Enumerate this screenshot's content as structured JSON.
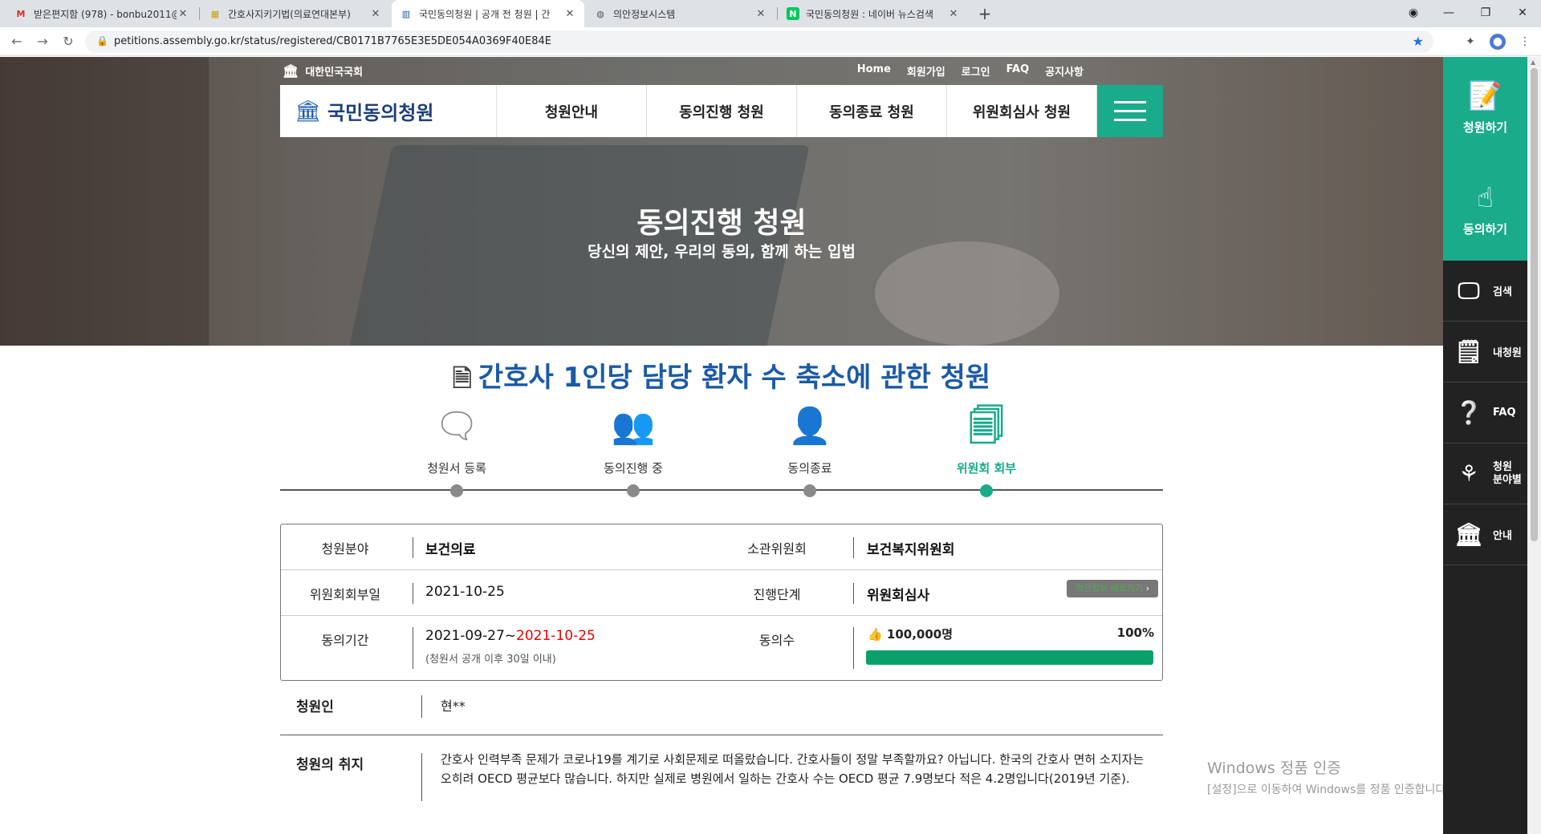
{
  "browser": {
    "tabs": [
      {
        "title": "받은편지함 (978) - bonbu2011@",
        "favicon": "M"
      },
      {
        "title": "간호사지키기법(의료연대본부)",
        "favicon": "▦"
      },
      {
        "title": "국민동의청원 | 공개 전 청원 | 간",
        "favicon": "▥"
      },
      {
        "title": "의안정보시스템",
        "favicon": "◍"
      },
      {
        "title": "국민동의청원 : 네이버 뉴스검색",
        "favicon": "N"
      }
    ],
    "new_tab": "+",
    "url": "petitions.assembly.go.kr/status/registered/CB0171B7765E3E5DE054A0369F40E84E"
  },
  "site": {
    "gov_name": "대한민국국회",
    "util_nav": [
      "Home",
      "회원가입",
      "로그인",
      "FAQ",
      "공지사항"
    ],
    "logo": "국민동의청원",
    "menu": [
      "청원안내",
      "동의진행 청원",
      "동의종료 청원",
      "위원회심사 청원"
    ],
    "hero_title": "동의진행 청원",
    "hero_sub": "당신의 제안, 우리의 동의, 함께 하는 입법"
  },
  "sidebar": {
    "big": [
      {
        "label": "청원하기",
        "icon": "document-pen-icon"
      },
      {
        "label": "동의하기",
        "icon": "hand-pointer-icon"
      }
    ],
    "items": [
      {
        "label": "검색",
        "icon": "search-monitor-icon"
      },
      {
        "label": "내청원",
        "icon": "my-petition-icon"
      },
      {
        "label": "FAQ",
        "icon": "faq-monitor-icon"
      },
      {
        "label": "청원\n분야별",
        "icon": "org-chart-icon"
      },
      {
        "label": "안내",
        "icon": "building-info-icon"
      }
    ]
  },
  "petition": {
    "title": "간호사 1인당 담당 환자 수 축소에 관한 청원",
    "steps": [
      {
        "label": "청원서 등록",
        "active": false
      },
      {
        "label": "동의진행 중",
        "active": false
      },
      {
        "label": "동의종료",
        "active": false
      },
      {
        "label": "위원회 회부",
        "active": true
      }
    ],
    "info": {
      "field_label": "청원분야",
      "field_value": "보건의료",
      "committee_label": "소관위원회",
      "committee_value": "보건복지위원회",
      "referral_label": "위원회회부일",
      "referral_value": "2021-10-25",
      "stage_label": "진행단계",
      "stage_value": "위원회심사",
      "view_bill_button": "의안정보 바로가기",
      "period_label": "동의기간",
      "period_start": "2021-09-27~",
      "period_end": "2021-10-25",
      "period_note": "(청원서 공개 이후 30일 이내)",
      "count_label": "동의수",
      "count_value": "100,000명",
      "percent": "100%",
      "progress": 1.0
    },
    "petitioner_label": "청원인",
    "petitioner_value": "현**",
    "purpose_label": "청원의 취지",
    "purpose_text": "간호사 인력부족 문제가 코로나19를 계기로 사회문제로 떠올랐습니다. 간호사들이 정말 부족할까요? 아닙니다. 한국의 간호사 면허 소지자는 오히려 OECD 평균보다 많습니다. 하지만 실제로 병원에서 일하는 간호사 수는 OECD 평균 7.9명보다 적은 4.2명입니다(2019년 기준)."
  },
  "windows_watermark": {
    "line1": "Windows 정품 인증",
    "line2": "[설정]으로 이동하여 Windows를 정품 인증합니다."
  },
  "colors": {
    "accent": "#1aab8a",
    "brand": "#1b5aa6",
    "progress": "#0aa06b",
    "deadline": "#e00000"
  }
}
